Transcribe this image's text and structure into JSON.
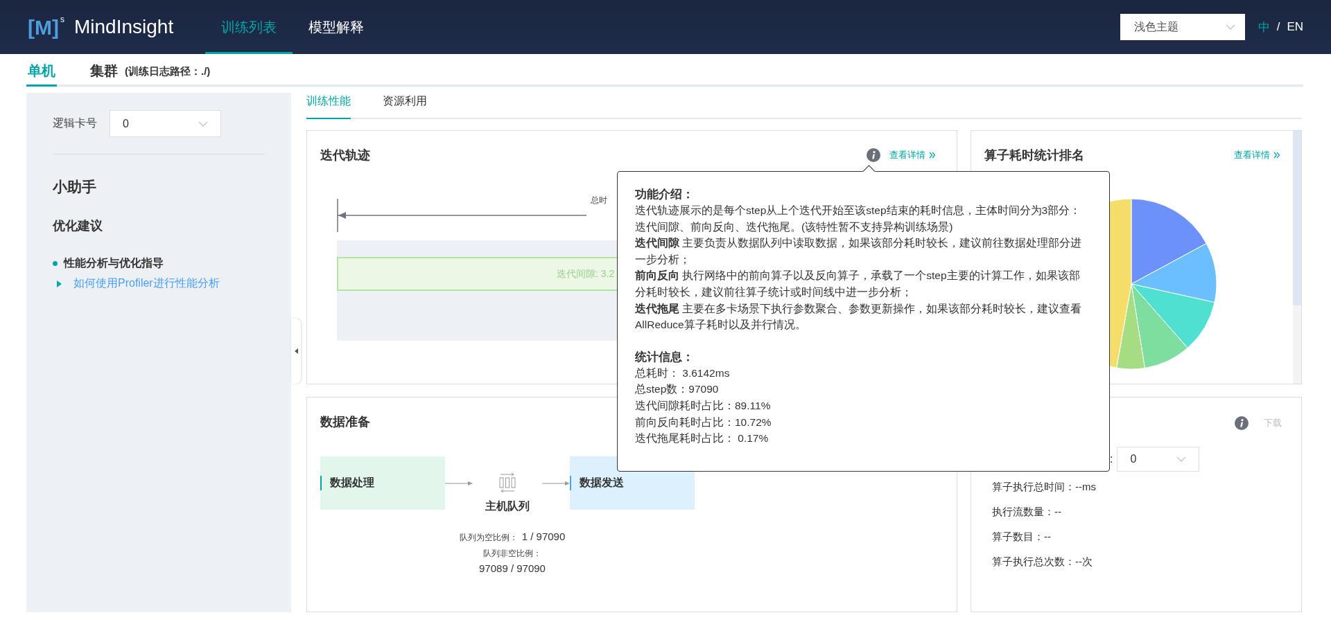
{
  "header": {
    "logo": {
      "mark": "[M]$^{s}$",
      "name": "MindInsight"
    },
    "nav": [
      {
        "label": "训练列表",
        "selected": true
      },
      {
        "label": "模型解释",
        "selected": false
      }
    ],
    "theme_select": {
      "value": "浅色主题"
    },
    "languages": [
      {
        "label": "中",
        "selected": true
      },
      {
        "label": "EN",
        "selected": false
      }
    ],
    "lang_separator": "/"
  },
  "mode_tabs": [
    {
      "label": "单机",
      "selected": true
    },
    {
      "label": "集群",
      "selected": false
    }
  ],
  "log_path": "(训练日志路径：./)",
  "sidebar": {
    "card_label": "逻辑卡号",
    "card_select": "0",
    "assistant_title": "小助手",
    "section_title": "优化建议",
    "items": [
      {
        "kind": "bullet",
        "text": "性能分析与优化指导"
      },
      {
        "kind": "link",
        "text": "如何使用Profiler进行性能分析"
      }
    ]
  },
  "tabs": [
    {
      "label": "训练性能",
      "selected": true
    },
    {
      "label": "资源利用",
      "selected": false
    }
  ],
  "step_trace": {
    "title": "迭代轨迹",
    "details_link": "查看详情",
    "total_label": "总时",
    "interval_label": "迭代间隙: 3.2"
  },
  "op_ranking": {
    "title": "算子耗时统计排名",
    "details_link": "查看详情"
  },
  "data_prep": {
    "title": "数据准备",
    "source": "数据处理",
    "queue": "主机队列",
    "sink": "数据发送",
    "empty_label": "队列为空比例：",
    "empty_value": "1 / 97090",
    "nonempty_label": "队列非空比例：",
    "nonempty_value": "97089 / 97090"
  },
  "op_stats": {
    "download": "下载",
    "download_disabled": true,
    "partial_label": ":",
    "select": "0",
    "lines": [
      "算子执行总时间：--ms",
      "执行流数量：--",
      "算子数目：--",
      "算子执行总次数：--次"
    ]
  },
  "tooltip": {
    "sections": [
      {
        "title": "功能介绍：",
        "paragraphs": [
          "迭代轨迹展示的是每个step从上个迭代开始至该step结束的耗时信息，主体时间分为3部分：迭代间隙、前向反向、迭代拖尾。(该特性暂不支持异构训练场景)",
          "**迭代间隙** 主要负责从数据队列中读取数据，如果该部分耗时较长，建议前往数据处理部分进一步分析；",
          "**前向反向** 执行网络中的前向算子以及反向算子，承载了一个step主要的计算工作，如果该部分耗时较长，建议前往算子统计或时间线中进一步分析；",
          "**迭代拖尾** 主要在多卡场景下执行参数聚合、参数更新操作，如果该部分耗时较长，建议查看AllReduce算子耗时以及并行情况。"
        ]
      },
      {
        "title": "统计信息：",
        "paragraphs": [
          "总耗时：  3.6142ms",
          "总step数：97090",
          "迭代间隙耗时占比：89.11%",
          "前向反向耗时占比：10.72%",
          "迭代拖尾耗时占比：  0.17%"
        ]
      }
    ]
  }
}
